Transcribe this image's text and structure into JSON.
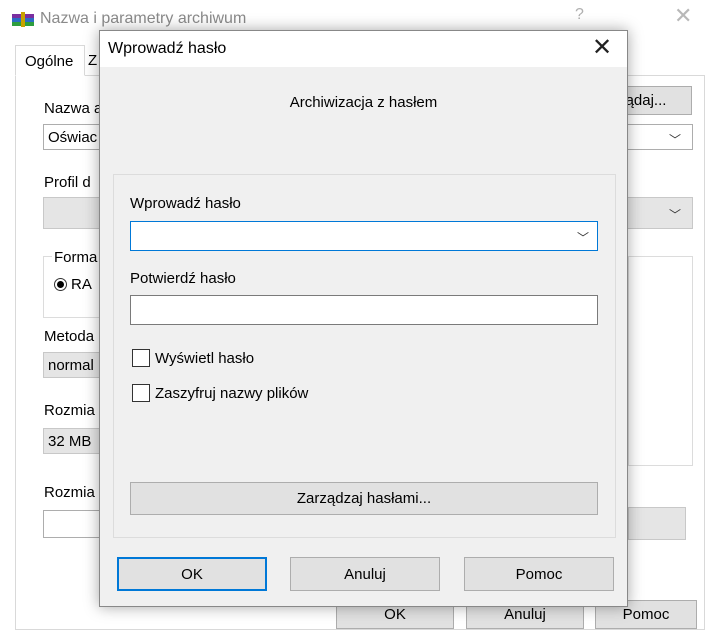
{
  "background_dialog": {
    "title": "Nazwa i parametry archiwum",
    "help_glyph": "?",
    "close_glyph": "✕",
    "icon": "winrar-icon",
    "tabs": {
      "active": "Ogólne",
      "next_partial": "Z"
    },
    "name_label": "Nazwa a",
    "browse_button": "ądaj...",
    "name_value": "Oświac",
    "profile_label": "Profil d",
    "format_label": "Forma",
    "format_option": "RA",
    "method_label": "Metoda",
    "method_value": "normal",
    "dict_label": "Rozmia",
    "dict_value": "32 MB",
    "split_label": "Rozmia",
    "ok_label": "OK",
    "cancel_label": "Anuluj",
    "help_label": "Pomoc"
  },
  "password_dialog": {
    "title": "Wprowadź hasło",
    "close_glyph": "✕",
    "heading": "Archiwizacja z hasłem",
    "enter_label": "Wprowadź hasło",
    "enter_value": "",
    "confirm_label": "Potwierdź hasło",
    "confirm_value": "",
    "show_password_label": "Wyświetl hasło",
    "encrypt_names_label": "Zaszyfruj nazwy plików",
    "manage_button": "Zarządzaj hasłami...",
    "ok_button": "OK",
    "cancel_button": "Anuluj",
    "help_button": "Pomoc",
    "chevron_glyph": "﹀"
  },
  "colors": {
    "accent": "#0078d7",
    "dialog_bg": "#f0f0f0",
    "button_bg": "#e1e1e1"
  }
}
